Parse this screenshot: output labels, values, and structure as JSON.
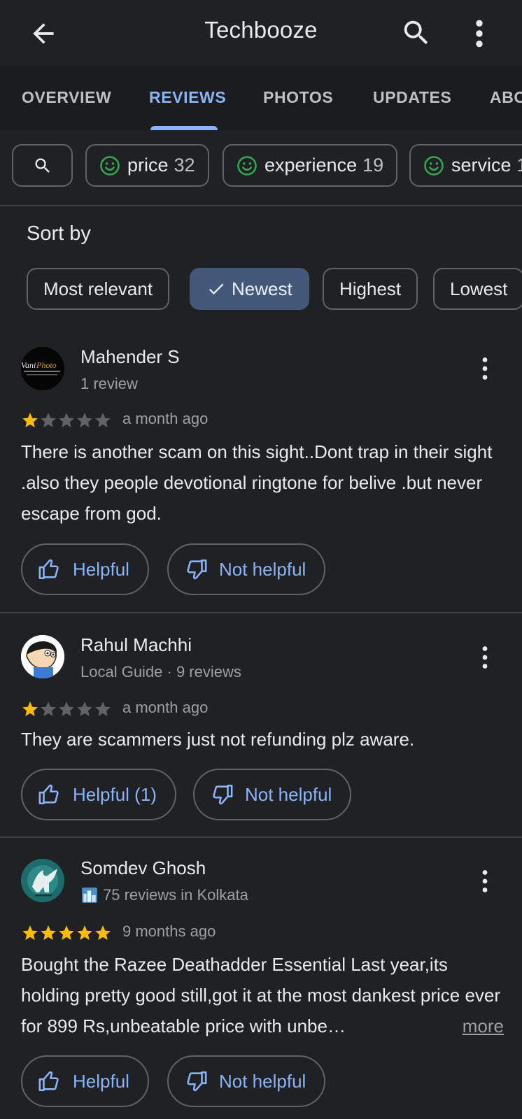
{
  "header": {
    "title": "Techbooze",
    "back_icon": "arrow-back-icon",
    "search_icon": "search-icon",
    "more_icon": "more-vert-icon"
  },
  "tabs": [
    {
      "label": "OVERVIEW",
      "active": false
    },
    {
      "label": "REVIEWS",
      "active": true
    },
    {
      "label": "PHOTOS",
      "active": false
    },
    {
      "label": "UPDATES",
      "active": false
    },
    {
      "label": "ABO",
      "active": false
    }
  ],
  "topic_chips": [
    {
      "label": "price",
      "count": "32"
    },
    {
      "label": "experience",
      "count": "19"
    },
    {
      "label": "service",
      "count": "1"
    }
  ],
  "sort": {
    "title": "Sort by",
    "options": [
      {
        "label": "Most relevant",
        "selected": false
      },
      {
        "label": "Newest",
        "selected": true
      },
      {
        "label": "Highest",
        "selected": false
      },
      {
        "label": "Lowest",
        "selected": false
      }
    ]
  },
  "reviews": [
    {
      "name": "Mahender S",
      "subtitle": "1 review",
      "rating": 1,
      "time": "a month ago",
      "text": "There is another scam on this sight..Dont trap in their sight  .also they people devotional ringtone for belive .but never escape from god.",
      "helpful_label": "Helpful",
      "not_helpful_label": "Not helpful",
      "avatar_text": "VaniPhoto"
    },
    {
      "name": "Rahul Machhi",
      "subtitle": "Local Guide · 9 reviews",
      "rating": 1,
      "time": "a month ago",
      "text": "They are scammers just not refunding plz aware.",
      "helpful_label": "Helpful (1)",
      "not_helpful_label": "Not helpful"
    },
    {
      "name": "Somdev Ghosh",
      "subtitle": "75 reviews in Kolkata",
      "rating": 5,
      "time": "9 months ago",
      "text": "Bought the Razee Deathadder Essential Last year,its holding pretty good still,got it at the most dankest price ever for 899 Rs,unbeatable price with unbe…",
      "more_label": "more",
      "helpful_label": "Helpful",
      "not_helpful_label": "Not helpful"
    }
  ],
  "colors": {
    "background": "#202124",
    "accent": "#8ab4f8",
    "star": "#fbbc04",
    "star_empty": "#5f6368",
    "positive": "#34a853",
    "selected_chip": "#44587a"
  }
}
